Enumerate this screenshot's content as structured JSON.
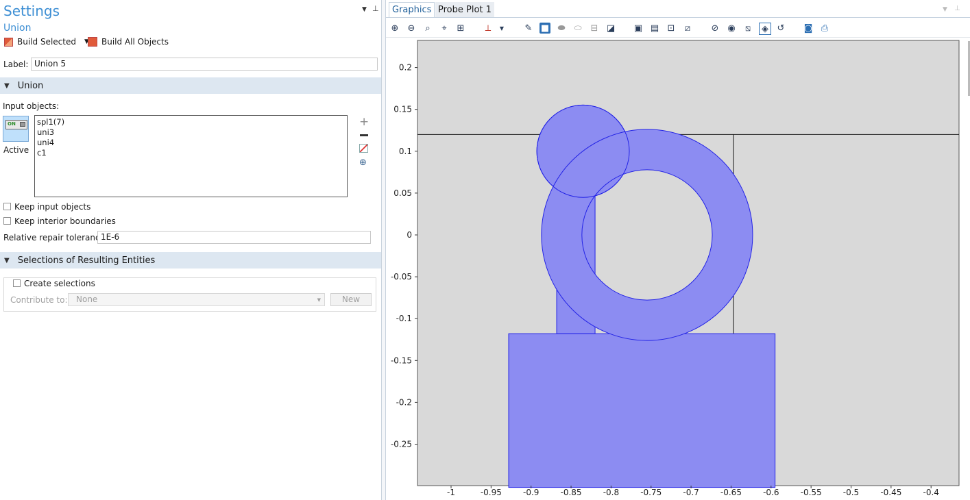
{
  "settings": {
    "panel_title": "Settings",
    "node_type": "Union",
    "build_selected_label": "Build Selected",
    "build_all_label": "Build All Objects",
    "label_caption": "Label:",
    "label_value": "Union 5"
  },
  "union_section": {
    "header": "Union",
    "input_objects_caption": "Input objects:",
    "active_toggle_text": "ON",
    "active_label": "Active",
    "input_objects": [
      "spl1(7)",
      "uni3",
      "uni4",
      "c1"
    ],
    "keep_input_label": "Keep input objects",
    "keep_interior_label": "Keep interior boundaries",
    "tolerance_caption": "Relative repair tolerance:",
    "tolerance_value": "1E-6"
  },
  "selections_section": {
    "header": "Selections of Resulting Entities",
    "create_selections_label": "Create selections",
    "contribute_caption": "Contribute to:",
    "contribute_value": "None",
    "new_button": "New"
  },
  "graphics": {
    "tabs": [
      "Graphics",
      "Probe Plot 1"
    ],
    "active_tab": "Graphics",
    "toolbar_icons": [
      "zoom-in-icon",
      "zoom-out-icon",
      "zoom-box-icon",
      "zoom-selected-icon",
      "zoom-extents-icon",
      "axis-orientation-icon",
      "select-objects-icon",
      "select-domains-icon",
      "select-boundaries-icon",
      "select-edges-icon",
      "select-points-icon",
      "select-box-icon",
      "clear-selection-icon",
      "hide-icon",
      "show-icon",
      "wireframe-icon",
      "transparency-icon",
      "reset-icon",
      "screenshot-icon",
      "print-icon"
    ],
    "x_ticks": [
      "-1",
      "-0.95",
      "-0.9",
      "-0.85",
      "-0.8",
      "-0.75",
      "-0.7",
      "-0.65",
      "-0.6",
      "-0.55",
      "-0.5",
      "-0.45",
      "-0.4"
    ],
    "y_ticks": [
      "0.2",
      "0.15",
      "0.1",
      "0.05",
      "0",
      "-0.05",
      "-0.1",
      "-0.15",
      "-0.2",
      "-0.25"
    ],
    "x_range": [
      -1.04,
      -0.4
    ],
    "y_range": [
      -0.3,
      0.235
    ],
    "colors": {
      "background": "#d9d9d9",
      "geometry_fill": "#8c8cf2",
      "geometry_edge": "#2323e6"
    }
  }
}
